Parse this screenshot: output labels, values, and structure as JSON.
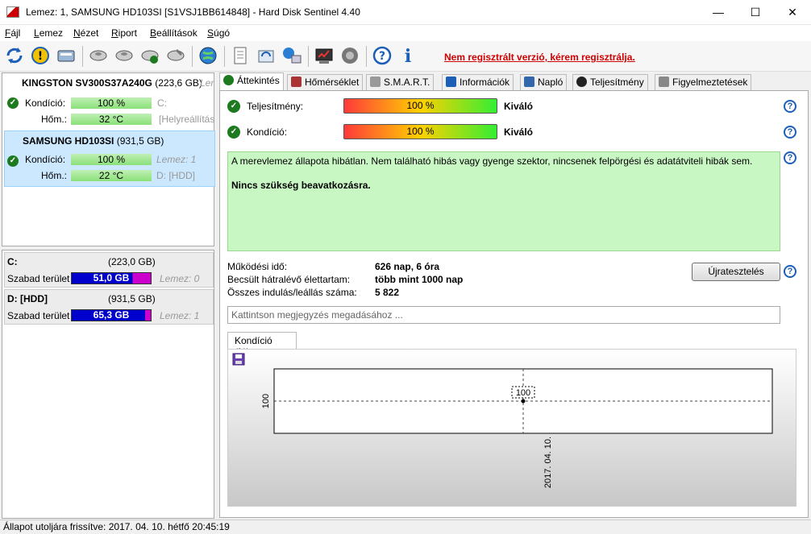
{
  "window": {
    "title": "Lemez: 1, SAMSUNG HD103SI [S1VSJ1BB614848]  -  Hard Disk Sentinel 4.40",
    "minimize": "—",
    "maximize": "☐",
    "close": "✕"
  },
  "menu": [
    {
      "key": "F",
      "rest": "ájl"
    },
    {
      "key": "L",
      "rest": "emez"
    },
    {
      "key": "N",
      "rest": "ézet"
    },
    {
      "key": "R",
      "rest": "iport"
    },
    {
      "key": "B",
      "rest": "eállítások"
    },
    {
      "key": "S",
      "rest": "úgó"
    }
  ],
  "toolbar": {
    "register_link": "Nem regisztrált verzió, kérem regisztrálja.",
    "icons": [
      "refresh-icon",
      "alert-icon",
      "disk-icon",
      "disk-test-icon",
      "disk-test2-icon",
      "disk-ok-icon",
      "disk-tool-icon",
      "globe-icon",
      "report-icon",
      "sync-icon",
      "network-icon",
      "chart-icon",
      "speaker-icon",
      "help-icon",
      "info-icon"
    ]
  },
  "disks": [
    {
      "name": "KINGSTON SV300S37A240G",
      "size": "(223,6 GB)",
      "extra": "Len",
      "condition_label": "Kondíció:",
      "condition": "100 %",
      "temp_label": "Hőm.:",
      "temp": "32 °C",
      "drive": "C:",
      "drive_note": "[Helyreállítás"
    },
    {
      "name": "SAMSUNG HD103SI",
      "size": "(931,5 GB)",
      "condition_label": "Kondíció:",
      "condition": "100 %",
      "temp_label": "Hőm.:",
      "temp": "22 °C",
      "disk_label": "Lemez: 1",
      "drive": "D: [HDD]"
    }
  ],
  "volumes": [
    {
      "name": "C:",
      "size": "(223,0 GB)",
      "free_label": "Szabad terület",
      "free": "51,0 GB",
      "disk": "Lemez: 0",
      "free_fraction": 0.77
    },
    {
      "name": "D: [HDD]",
      "size": "(931,5 GB)",
      "free_label": "Szabad terület",
      "free": "65,3 GB",
      "disk": "Lemez: 1",
      "free_fraction": 0.93
    }
  ],
  "tabs": [
    {
      "label": "Áttekintés",
      "icon": "check-icon",
      "color": "#1e7a1e"
    },
    {
      "label": "Hőmérséklet",
      "icon": "thermometer-icon",
      "color": "#a33"
    },
    {
      "label": "S.M.A.R.T.",
      "icon": "smart-icon",
      "color": "#777"
    },
    {
      "label": "Információk",
      "icon": "info-icon",
      "color": "#1c5fb8"
    },
    {
      "label": "Napló",
      "icon": "log-icon",
      "color": "#36a"
    },
    {
      "label": "Teljesítmény",
      "icon": "gauge-icon",
      "color": "#222"
    },
    {
      "label": "Figyelmeztetések",
      "icon": "alerts-icon",
      "color": "#666"
    }
  ],
  "overview": {
    "performance_label": "Teljesítmény:",
    "performance_value": "100 %",
    "performance_rating": "Kiváló",
    "performance_fraction": 1.0,
    "condition_label": "Kondíció:",
    "condition_value": "100 %",
    "condition_rating": "Kiváló",
    "condition_fraction": 1.0,
    "message": "A merevlemez állapota hibátlan. Nem található hibás vagy gyenge szektor, nincsenek felpörgési és adatátviteli hibák sem.",
    "message_bold": "Nincs szükség beavatkozásra.",
    "uptime_label": "Működési idő:",
    "uptime": "626 nap, 6 óra",
    "remaining_label": "Becsült hátralévő élettartam:",
    "remaining": "több mint 1000 nap",
    "starts_label": "Összes indulás/leállás száma:",
    "starts": "5 822",
    "restart_button": "Újratesztelés",
    "note_placeholder": "Kattintson megjegyzés megadásához ...",
    "graph_tab": "Kondíció  (%)",
    "help": "?"
  },
  "chart_data": {
    "type": "line",
    "x": [
      "2017. 04. 10."
    ],
    "series": [
      {
        "values": [
          100
        ]
      }
    ],
    "ylabel": "",
    "y_tick": "100",
    "data_label": "100"
  },
  "status": "Állapot utoljára frissítve: 2017. 04. 10. hétfő 20:45:19"
}
